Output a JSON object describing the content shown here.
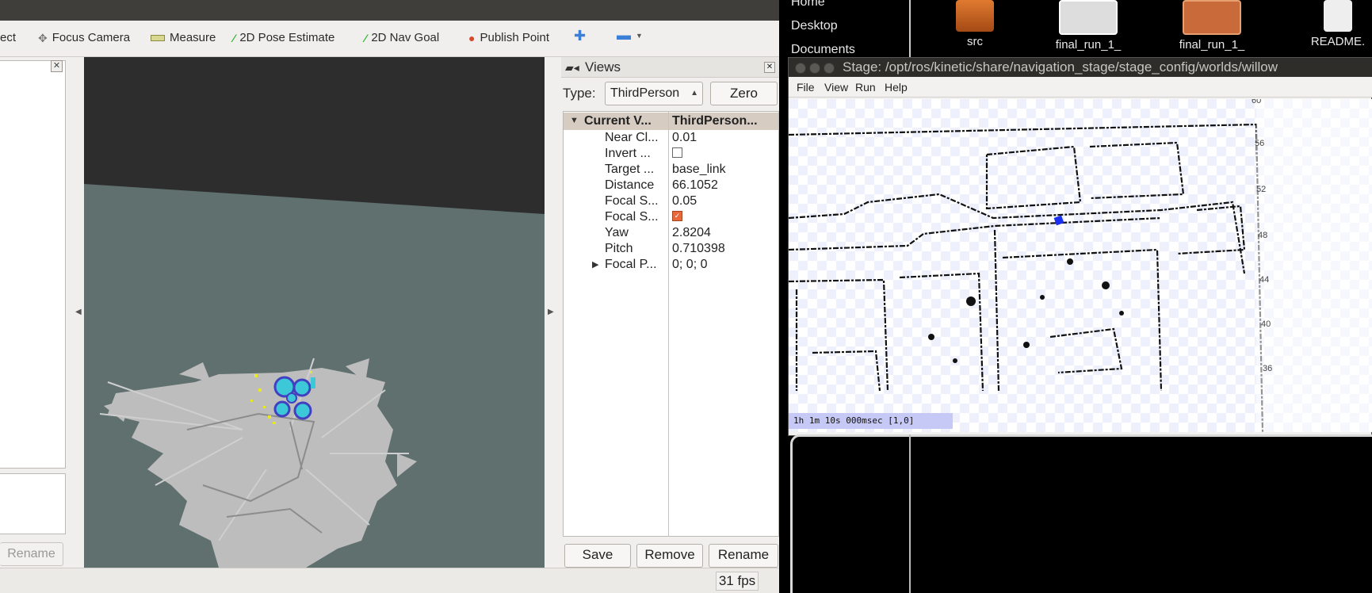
{
  "rviz": {
    "toolbar": {
      "items": [
        {
          "label": "ect"
        },
        {
          "label": "Focus Camera"
        },
        {
          "label": "Measure"
        },
        {
          "label": "2D Pose Estimate"
        },
        {
          "label": "2D Nav Goal"
        },
        {
          "label": "Publish Point"
        }
      ]
    },
    "left_panel": {
      "rename_label": "Rename"
    },
    "views_panel": {
      "title": "Views",
      "type_label": "Type:",
      "type_value": "ThirdPerson",
      "zero_label": "Zero",
      "header": {
        "key": "Current V...",
        "value": "ThirdPerson..."
      },
      "properties": [
        {
          "key": "Near Cl...",
          "value": "0.01"
        },
        {
          "key": "Invert ...",
          "checkbox": false
        },
        {
          "key": "Target ...",
          "value": "base_link"
        },
        {
          "key": "Distance",
          "value": "66.1052"
        },
        {
          "key": "Focal S...",
          "value": "0.05"
        },
        {
          "key": "Focal S...",
          "checkbox": true
        },
        {
          "key": "Yaw",
          "value": "2.8204"
        },
        {
          "key": "Pitch",
          "value": "0.710398"
        },
        {
          "key": "Focal P...",
          "value": "0; 0; 0"
        }
      ],
      "buttons": {
        "save": "Save",
        "remove": "Remove",
        "rename": "Rename"
      }
    },
    "status": {
      "fps": "31 fps"
    },
    "colors": {
      "background_3d": "#5f706f",
      "sky_3d": "#2d2d2d",
      "accent_checkbox": "#e8673b"
    }
  },
  "desktop": {
    "sidebar_items": [
      "Home",
      "Desktop",
      "Documents"
    ],
    "icons": [
      {
        "label": "src",
        "icon": "folder-icon"
      },
      {
        "label": "final_run_1_",
        "icon": "image-thumbnail-icon"
      },
      {
        "label": "final_run_1_",
        "icon": "image-thumbnail-icon"
      },
      {
        "label": "README.",
        "icon": "text-file-icon"
      }
    ]
  },
  "stage": {
    "title": "Stage: /opt/ros/kinetic/share/navigation_stage/stage_config/worlds/willow",
    "menu": [
      "File",
      "View",
      "Run",
      "Help"
    ],
    "y_ticks": [
      "60",
      "56",
      "52",
      "48",
      "44",
      "40",
      "36"
    ],
    "status": "1h 1m 10s 000msec [1,0]"
  }
}
